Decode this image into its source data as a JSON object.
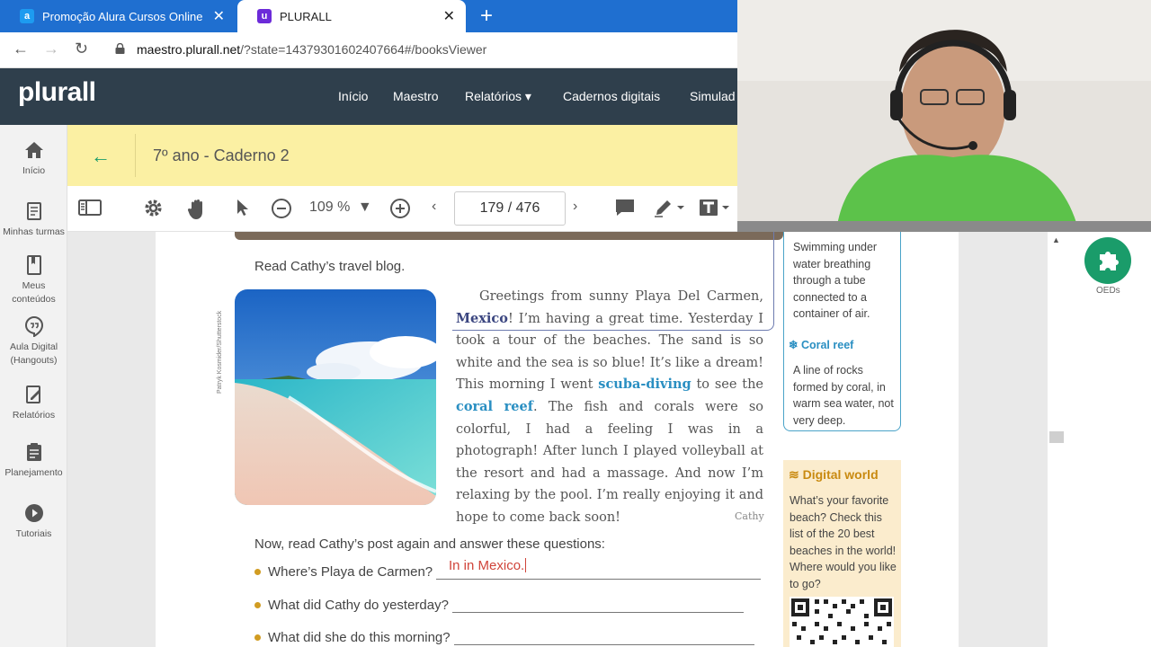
{
  "browser": {
    "tabs": [
      {
        "title": "Promoção Alura Cursos Online",
        "favicon": "a"
      },
      {
        "title": "PLURALL",
        "favicon": "u"
      }
    ],
    "new_tab_label": "+",
    "url_domain": "maestro.plurall.net",
    "url_path": "/?state=14379301602407664#/booksViewer"
  },
  "app": {
    "logo": "plurall",
    "nav": [
      "Início",
      "Maestro",
      "Relatórios ▾",
      "Cadernos digitais",
      "Simulad"
    ]
  },
  "sidebar": {
    "items": [
      {
        "label": "Início",
        "icon": "home-icon"
      },
      {
        "label": "Minhas turmas",
        "icon": "classes-icon"
      },
      {
        "label": "Meus conteúdos",
        "icon": "bookmark-icon"
      },
      {
        "label": "Aula Digital (Hangouts)",
        "icon": "hangouts-icon"
      },
      {
        "label": "Relatórios",
        "icon": "report-icon"
      },
      {
        "label": "Planejamento",
        "icon": "clipboard-icon"
      },
      {
        "label": "Tutoriais",
        "icon": "play-icon"
      }
    ]
  },
  "book": {
    "title": "7º ano - Caderno 2"
  },
  "toolbar": {
    "zoom": "109 %",
    "page": "179 / 476"
  },
  "page_content": {
    "intro": "Read Cathy’s travel blog.",
    "photo_credit": "Patryk Kosmider/Shutterstock",
    "blog_p1": "Greetings from sunny Playa Del Carmen, ",
    "blog_mexico": "Mexico",
    "blog_p2": "! I’m having a great time. Yesterday I took a tour of the beaches. The sand is so white and the sea is so blue! It’s like a dream! This morning I went ",
    "blog_scuba": "scuba-diving",
    "blog_p3": " to see the ",
    "blog_coral": "coral reef",
    "blog_p4": ". The fish and corals were so colorful, I had a feeling I was in a photograph! After lunch I played volleyball at the resort and had a massage. And now I’m relaxing by the pool. I’m really enjoying it and hope to come back soon!",
    "signature": "Cathy",
    "questions_intro": "Now, read Cathy’s post again and answer these questions:",
    "questions": [
      "Where’s Playa de Carmen?",
      "What did Cathy do yesterday?",
      "What did she do this morning?"
    ],
    "answer_1": "In in Mexico."
  },
  "glossary": {
    "scuba_def": "Swimming under water breathing through a tube connected to a container of air.",
    "coral_head": "Coral reef",
    "coral_def": "A line of rocks formed by coral, in warm sea water, not very deep."
  },
  "digital_world": {
    "head": "Digital world",
    "text": "What’s your favorite beach? Check this list of the 20 best beaches in the world! Where would you like to go?"
  },
  "right_panel": {
    "oed_label": "OEDs"
  },
  "colors": {
    "tabbar": "#1f6fd0",
    "app_header": "#2f3f4c",
    "book_header": "#fbf0a3",
    "accent_green": "#1a9c6a",
    "answer_red": "#d0443a"
  }
}
